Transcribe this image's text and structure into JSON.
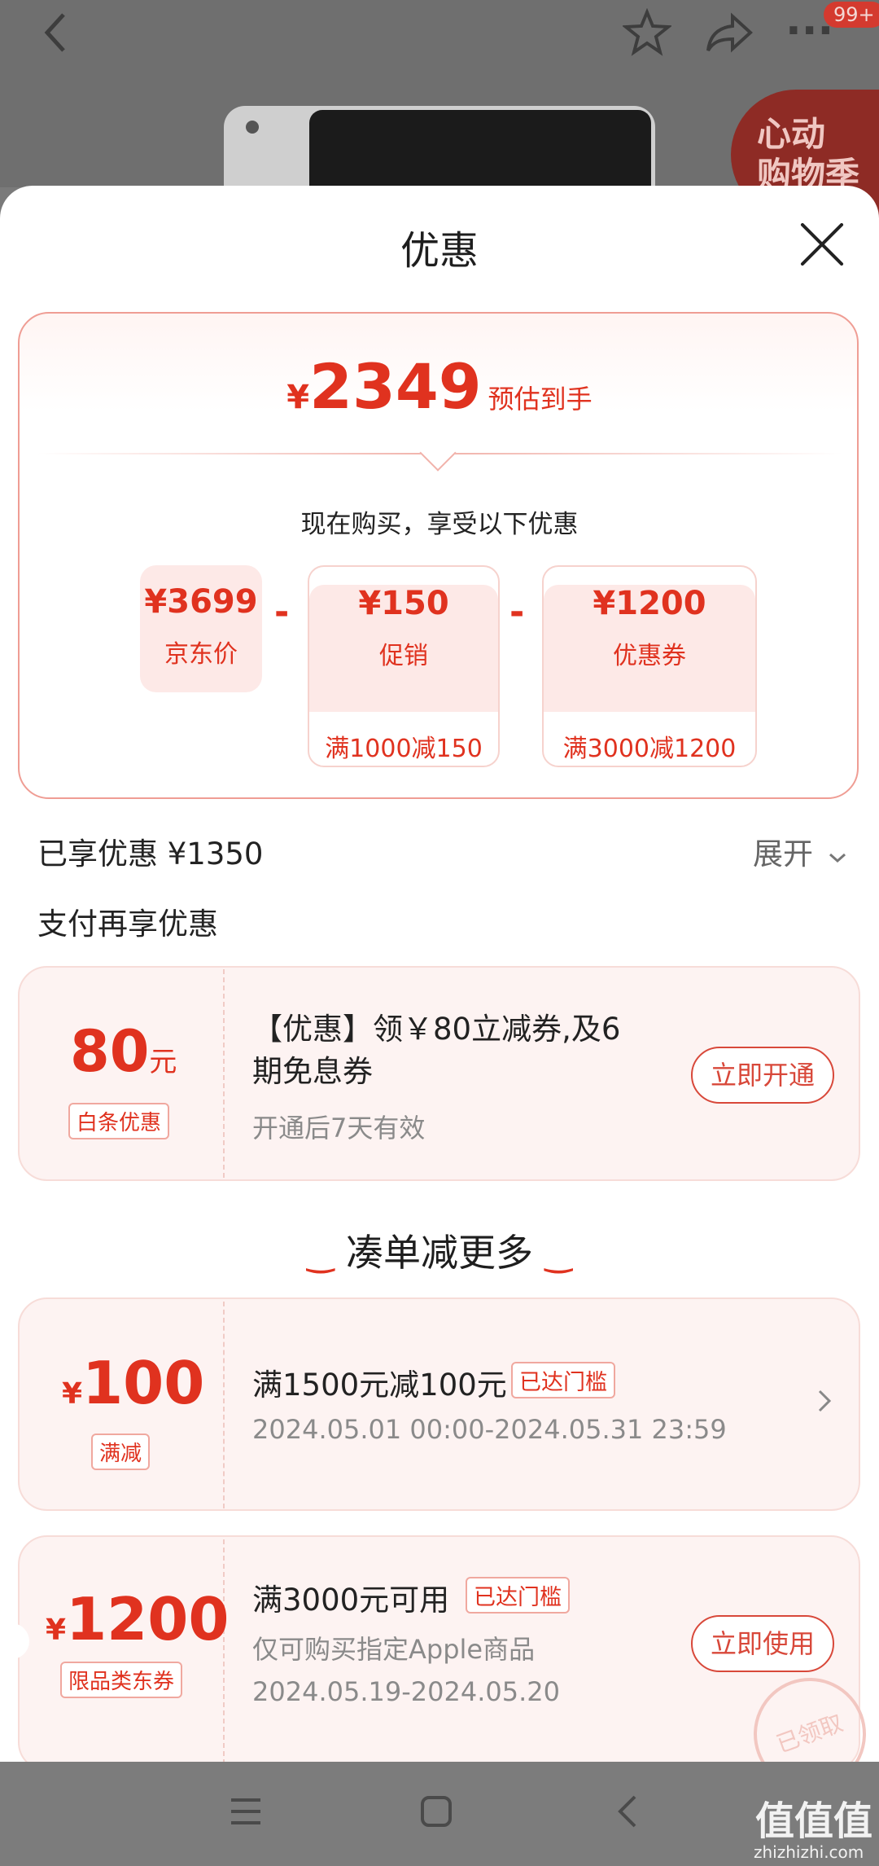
{
  "topbar": {
    "back_icon": "back-arrow-icon",
    "star_icon": "star-icon",
    "share_icon": "share-icon",
    "more_icon": "more-icon",
    "badge": "99+",
    "promo_line1": "心动",
    "promo_line2": "购物季"
  },
  "sheet": {
    "title": "优惠",
    "close_icon": "close-icon"
  },
  "summary": {
    "yen": "¥",
    "price": "2349",
    "price_note": "预估到手",
    "now_buy": "现在购买，享受以下优惠",
    "jd_price": "¥3699",
    "jd_price_label": "京东价",
    "promo_amount": "¥150",
    "promo_label": "促销",
    "promo_cond": "满1000减150",
    "coupon_amount": "¥1200",
    "coupon_label": "优惠券",
    "coupon_cond": "满3000减1200",
    "minus": "-"
  },
  "enjoyed": "已享优惠 ¥1350",
  "expand": "展开",
  "pay_title": "支付再享优惠",
  "baitiao": {
    "amount": "80",
    "unit": "元",
    "tag": "白条优惠",
    "text_line1": "【优惠】领￥80立减券,及6",
    "text_line2": "期免息券",
    "sub": "开通后7天有效",
    "button": "立即开通"
  },
  "more_title": "凑单减更多",
  "coupon1": {
    "yen": "¥",
    "amount": "100",
    "tag": "满减",
    "title": "满1500元减100元",
    "reached": "已达门槛",
    "period": "2024.05.01 00:00-2024.05.31 23:59"
  },
  "coupon2": {
    "yen": "¥",
    "amount": "1200",
    "tag": "限品类东券",
    "title": "满3000元可用",
    "reached": "已达门槛",
    "desc": "仅可购买指定Apple商品",
    "period": "2024.05.19-2024.05.20",
    "button": "立即使用",
    "stamp": "已领取"
  },
  "navbar": {
    "menu_icon": "menu-icon",
    "home_icon": "home-square-icon",
    "back_icon": "back-nav-icon"
  },
  "watermark": {
    "brand": "值值值",
    "url": "zhizhizhi.com"
  },
  "colors": {
    "accent": "#e0321f",
    "sheet_bg": "#ffffff",
    "overlay": "#6f6f6f"
  }
}
